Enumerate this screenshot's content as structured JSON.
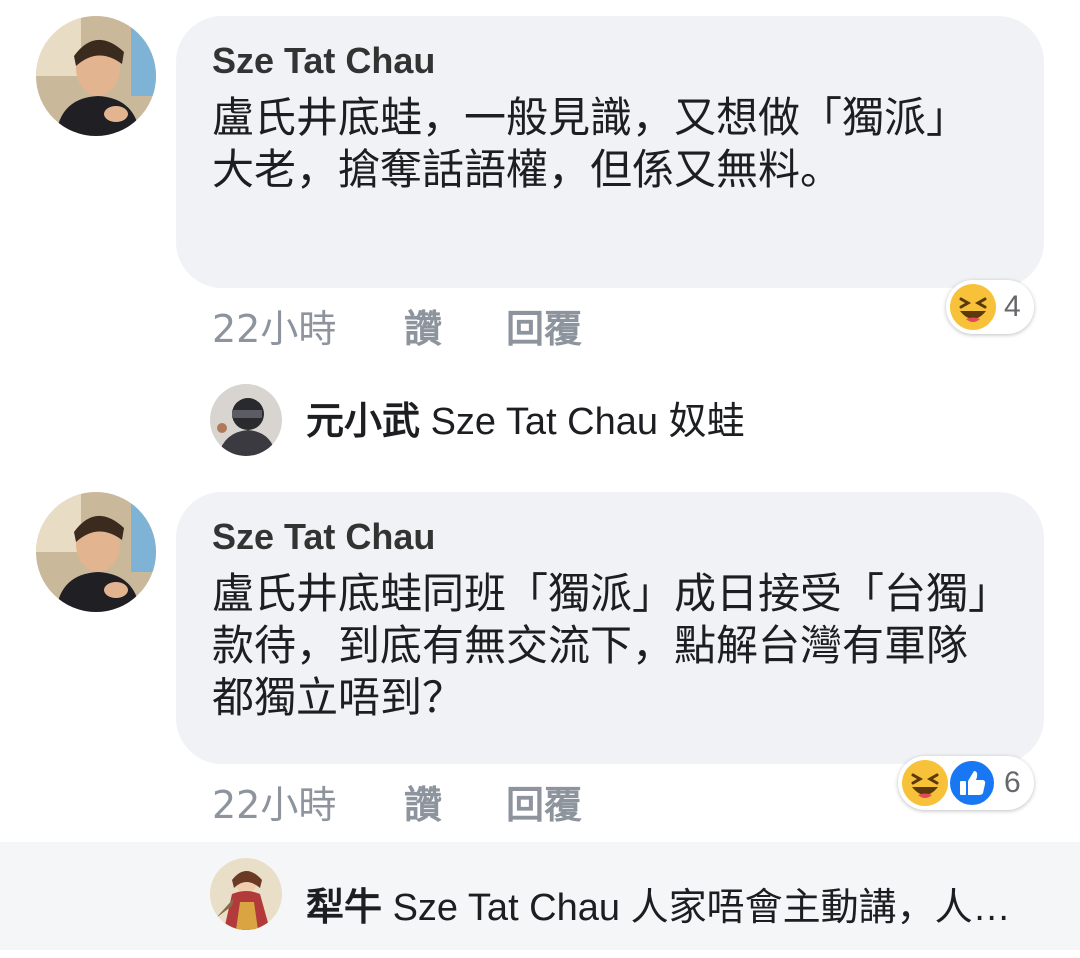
{
  "comments": [
    {
      "author": "Sze Tat Chau",
      "text": "盧氏井底蛙，一般見識，又想做「獨派」大老，搶奪話語權，但係又無料。",
      "time": "22小時",
      "like_label": "讚",
      "reply_label": "回覆",
      "reaction_count": "4",
      "reaction_icons": [
        "haha-icon"
      ]
    },
    {
      "author": "Sze Tat Chau",
      "text": "盧氏井底蛙同班「獨派」成日接受「台獨」款待，到底有無交流下，點解台灣有軍隊都獨立唔到？",
      "time": "22小時",
      "like_label": "讚",
      "reply_label": "回覆",
      "reaction_count": "6",
      "reaction_icons": [
        "haha-icon",
        "like-icon"
      ]
    }
  ],
  "replies": [
    {
      "author": "元小武",
      "text": "Sze Tat Chau 奴蛙"
    },
    {
      "author": "犁牛",
      "text": "Sze Tat Chau 人家唔會主動講，人…"
    }
  ],
  "colors": {
    "bubble": "#f0f2f5",
    "meta_text": "#8d949e",
    "like_blue": "#1877f2",
    "haha_yellow": "#f7c23a"
  }
}
